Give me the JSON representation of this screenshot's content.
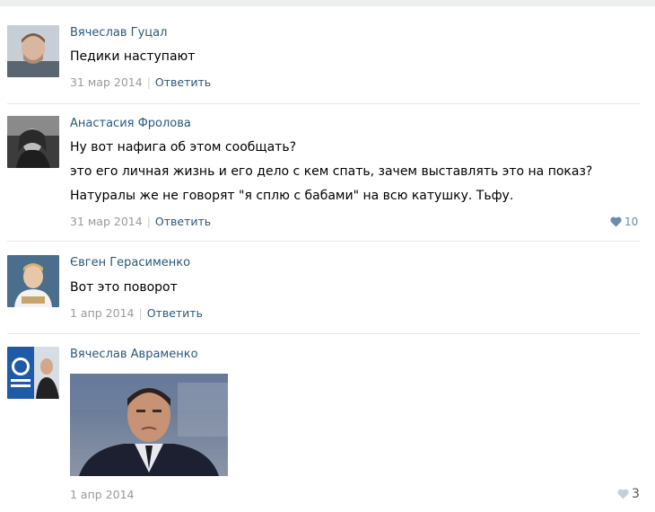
{
  "comments": [
    {
      "author": "Вячеслав Гуцал",
      "lines": [
        "Педики наступают"
      ],
      "date": "31 мар 2014",
      "reply": "Ответить"
    },
    {
      "author": "Анастасия Фролова",
      "lines": [
        "Ну вот нафига об этом сообщать?",
        "это его личная жизнь и его дело с кем спать, зачем выставлять это на показ?",
        "Натуралы же не говорят \"я сплю с бабами\" на всю катушку. Тьфу."
      ],
      "date": "31 мар 2014",
      "reply": "Ответить",
      "likes": "10"
    },
    {
      "author": "Євген Герасименко",
      "lines": [
        "Вот это поворот"
      ],
      "date": "1 апр 2014",
      "reply": "Ответить"
    },
    {
      "author": "Вячеслав Авраменко",
      "date": "1 апр 2014",
      "likes": "3"
    }
  ],
  "colors": {
    "link": "#2b587a",
    "meta": "#999999",
    "like_active": "#6a8bb0",
    "like_inactive": "#c7d0da",
    "divider": "#e7e8ec"
  },
  "icons": [
    "heart-icon"
  ]
}
